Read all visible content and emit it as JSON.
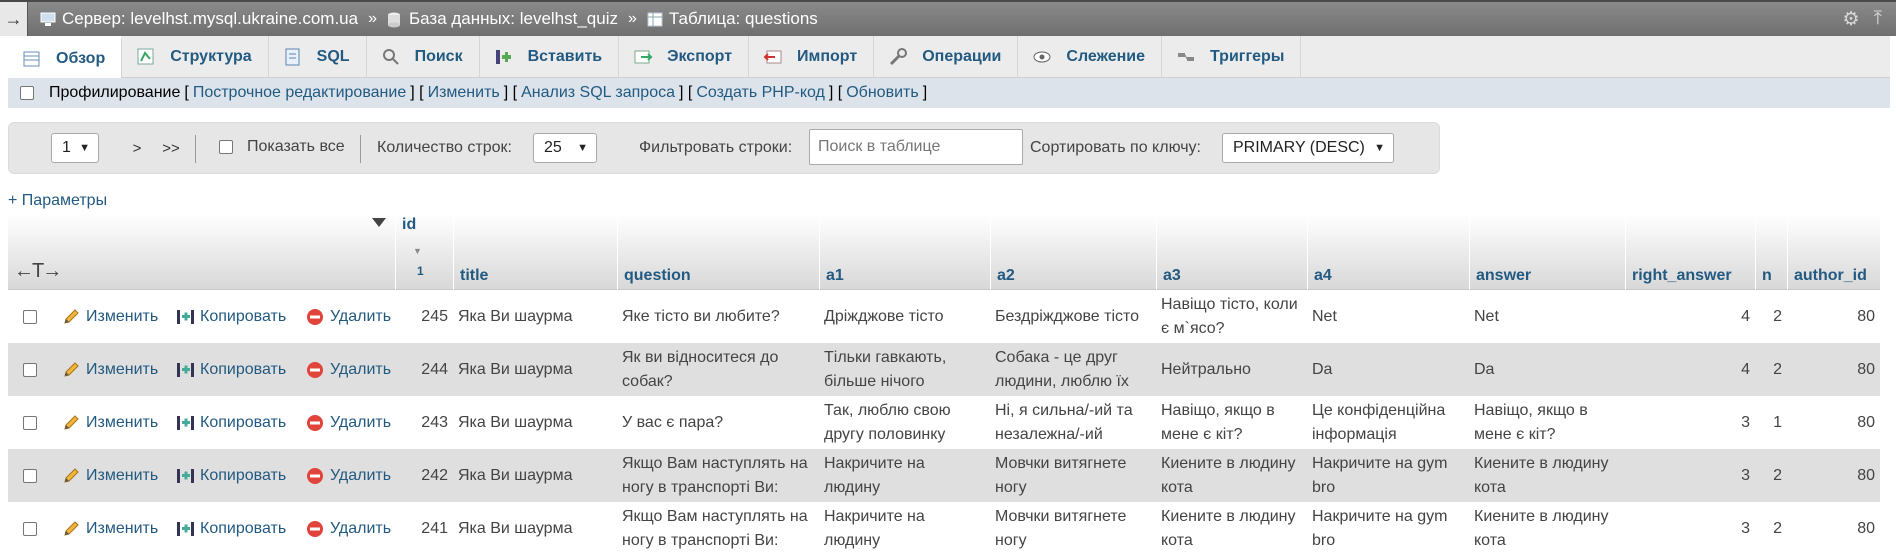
{
  "breadcrumb": {
    "back_arrow": "→",
    "server": "Сервер: levelhst.mysql.ukraine.com.ua",
    "database": "База данных: levelhst_quiz",
    "table": "Таблица: questions",
    "separator": "»",
    "icons": [
      "server-icon",
      "database-icon",
      "table-icon"
    ]
  },
  "window_icons": [
    "gear-icon",
    "collapse-icon"
  ],
  "tabs": [
    {
      "label": "Обзор",
      "icon": "browse-icon"
    },
    {
      "label": "Структура",
      "icon": "structure-icon"
    },
    {
      "label": "SQL",
      "icon": "sql-icon"
    },
    {
      "label": "Поиск",
      "icon": "search-icon"
    },
    {
      "label": "Вставить",
      "icon": "insert-icon"
    },
    {
      "label": "Экспорт",
      "icon": "export-icon"
    },
    {
      "label": "Импорт",
      "icon": "import-icon"
    },
    {
      "label": "Операции",
      "icon": "operations-icon"
    },
    {
      "label": "Слежение",
      "icon": "tracking-icon"
    },
    {
      "label": "Триггеры",
      "icon": "triggers-icon"
    }
  ],
  "profiling": {
    "label": "Профилирование",
    "links": [
      "Построчное редактирование",
      "Изменить",
      "Анализ SQL запроса",
      "Создать PHP-код",
      "Обновить"
    ]
  },
  "navigation": {
    "page_value": "1",
    "next": ">",
    "last": ">>",
    "show_all": "Показать все",
    "rows_label": "Количество строк:",
    "rows_value": "25",
    "filter_label": "Фильтровать строки:",
    "filter_placeholder": "Поиск в таблице",
    "sort_label": "Сортировать по ключу:",
    "sort_value": "PRIMARY (DESC)"
  },
  "params_link": "+ Параметры",
  "table": {
    "columns": [
      "id",
      "title",
      "question",
      "a1",
      "a2",
      "a3",
      "a4",
      "answer",
      "right_answer",
      "n",
      "author_id"
    ],
    "sort_indicator": "1",
    "action_labels": {
      "edit": "Изменить",
      "copy": "Копировать",
      "delete": "Удалить"
    },
    "rows": [
      {
        "id": "245",
        "title": "Яка Ви шаурма",
        "question": "Яке тісто ви любите?",
        "a1": "Дріжджове тісто",
        "a2": "Бездріжджове тісто",
        "a3": "Навіщо тісто, коли є м`ясо?",
        "a4": "Net",
        "answer": "Net",
        "right_answer": "4",
        "n": "2",
        "author_id": "80"
      },
      {
        "id": "244",
        "title": "Яка Ви шаурма",
        "question": "Як ви відноситеся до собак?",
        "a1": "Тільки гавкають, більше нічого",
        "a2": "Собака - це друг людини, люблю їх",
        "a3": "Нейтрально",
        "a4": "Da",
        "answer": "Da",
        "right_answer": "4",
        "n": "2",
        "author_id": "80"
      },
      {
        "id": "243",
        "title": "Яка Ви шаурма",
        "question": "У вас є пара?",
        "a1": "Так, люблю свою другу половинку",
        "a2": "Ні, я сильна/-ий та незалежна/-ий",
        "a3": "Навіщо, якщо в мене є кіт?",
        "a4": "Це конфіденційна інформація",
        "answer": "Навіщо, якщо в мене є кіт?",
        "right_answer": "3",
        "n": "1",
        "author_id": "80"
      },
      {
        "id": "242",
        "title": "Яка Ви шаурма",
        "question": "Якщо Вам наступлять на ногу в транспорті Ви:",
        "a1": "Накричите на людину",
        "a2": "Мовчки витягнете ногу",
        "a3": "Киените в людину кота",
        "a4": "Накричите на gym bro",
        "answer": "Киените в людину кота",
        "right_answer": "3",
        "n": "2",
        "author_id": "80"
      },
      {
        "id": "241",
        "title": "Яка Ви шаурма",
        "question": "Якщо Вам наступлять на ногу в транспорті Ви:",
        "a1": "Накричите на людину",
        "a2": "Мовчки витягнете ногу",
        "a3": "Киените в людину кота",
        "a4": "Накричите на gym bro",
        "answer": "Киените в людину кота",
        "right_answer": "3",
        "n": "2",
        "author_id": "80"
      }
    ]
  }
}
